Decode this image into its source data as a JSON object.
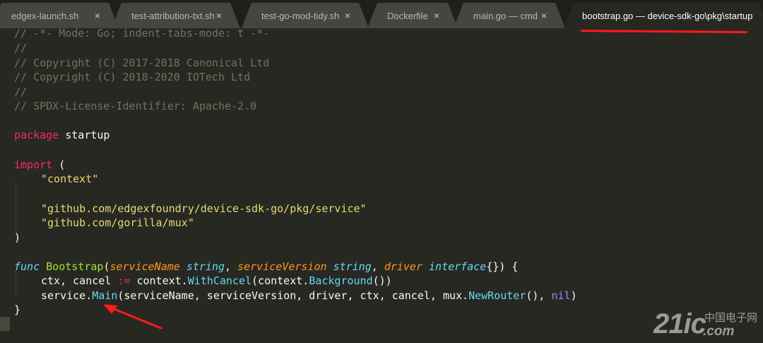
{
  "tabs": [
    {
      "label": "edgex-launch.sh",
      "close": "×"
    },
    {
      "label": "test-attribution-txt.sh",
      "close": "×"
    },
    {
      "label": "test-go-mod-tidy.sh",
      "close": "×"
    },
    {
      "label": "Dockerfile",
      "close": "×"
    },
    {
      "label": "main.go — cmd",
      "close": "×"
    },
    {
      "label": "bootstrap.go — device-sdk-go\\pkg\\startup",
      "active": true
    }
  ],
  "code": {
    "l1": "// -*- Mode: Go; indent-tabs-mode: t -*-",
    "l2": "//",
    "l3": "// Copyright (C) 2017-2018 Canonical Ltd",
    "l4": "// Copyright (C) 2018-2020 IOTech Ltd",
    "l5": "//",
    "l6": "// SPDX-License-Identifier: Apache-2.0",
    "pkg_kw": "package",
    "pkg_name": " startup",
    "import_kw": "import",
    "import_open": " (",
    "imp1": "\"context\"",
    "imp2": "\"github.com/edgexfoundry/device-sdk-go/pkg/service\"",
    "imp3": "\"github.com/gorilla/mux\"",
    "close_paren": ")",
    "func_kw": "func",
    "func_name": "Bootstrap",
    "p1": "serviceName",
    "t1": "string",
    "p2": "serviceVersion",
    "t2": "string",
    "p3": "driver",
    "t3": "interface",
    "sig_end": "{}) {",
    "l_ctx_a": "ctx, cancel ",
    "l_ctx_op": ":=",
    "l_ctx_b": " context.",
    "l_ctx_call": "WithCancel",
    "l_ctx_c": "(context.",
    "l_ctx_call2": "Background",
    "l_ctx_d": "())",
    "l_svc_a": "service.",
    "l_svc_call": "Main",
    "l_svc_b": "(serviceName, serviceVersion, driver, ctx, cancel, mux.",
    "l_svc_call2": "NewRouter",
    "l_svc_c": "(), ",
    "l_svc_nil": "nil",
    "l_svc_d": ")",
    "close_brace": "}"
  },
  "watermark": {
    "main": "21ic",
    "cn": "中国电子网",
    "com": ".com"
  },
  "colors": {
    "background": "#272822",
    "comment": "#75715e",
    "keyword": "#f92672",
    "string": "#e6db74",
    "function": "#a6e22e",
    "type": "#66d9ef",
    "param": "#fd971f",
    "constant": "#ae81ff",
    "annotation": "#ff1a1a"
  }
}
